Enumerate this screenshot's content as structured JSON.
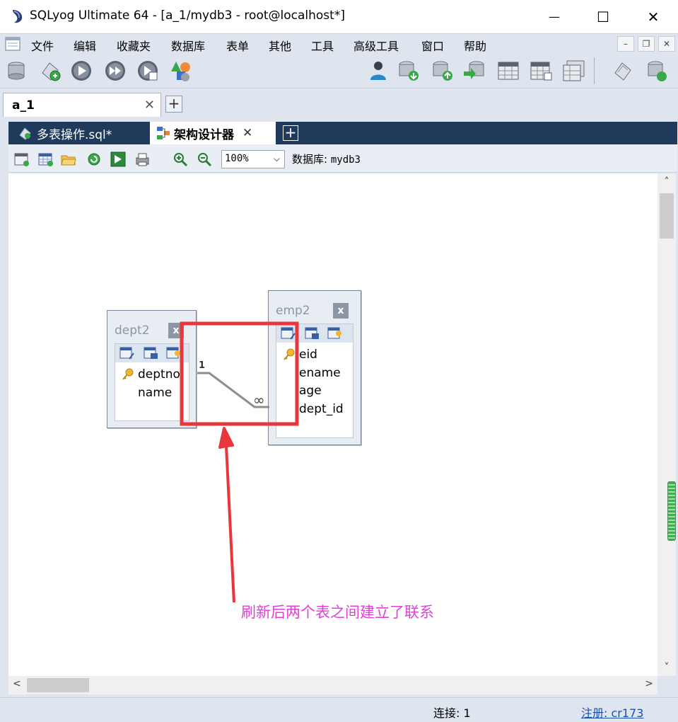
{
  "window": {
    "title": "SQLyog Ultimate 64 - [a_1/mydb3 - root@localhost*]",
    "minimize_glyph": "—",
    "maximize_glyph": "☐",
    "close_glyph": "✕"
  },
  "menu": {
    "items": [
      "文件",
      "编辑",
      "收藏夹",
      "数据库",
      "表单",
      "其他",
      "工具",
      "高级工具",
      "窗口",
      "帮助"
    ],
    "mdi_minimize": "–",
    "mdi_restore": "❐",
    "mdi_close": "✕"
  },
  "toolbar": {
    "database_selected": "mydb3",
    "icons": [
      "new-connection-icon",
      "refresh-connection-icon",
      "execute-query-icon",
      "execute-all-icon",
      "stop-query-icon",
      "shapes-icon",
      "user-manager-icon",
      "backup-database-icon",
      "restore-database-icon",
      "import-icon",
      "table-data-icon",
      "table-grid-icon",
      "table-copy-icon",
      "sql-formatter-icon",
      "db-sync-icon"
    ]
  },
  "connection_tabs": {
    "active_label": "a_1",
    "close_glyph": "✕",
    "add_glyph": "+"
  },
  "doc_tabs": {
    "sql_tab_label": "多表操作.sql*",
    "schema_tab_label": "架构设计器",
    "close_glyph": "✕",
    "add_glyph": "+"
  },
  "designer_toolbar": {
    "zoom_value": "100%",
    "database_label": "数据库:",
    "database_name": "mydb3"
  },
  "tables": [
    {
      "name": "dept2",
      "close_glyph": "x",
      "columns": [
        {
          "name": "deptno",
          "primary_key": true
        },
        {
          "name": "name",
          "primary_key": false
        }
      ]
    },
    {
      "name": "emp2",
      "close_glyph": "x",
      "columns": [
        {
          "name": "eid",
          "primary_key": true
        },
        {
          "name": "ename",
          "primary_key": false
        },
        {
          "name": "age",
          "primary_key": false
        },
        {
          "name": "dept_id",
          "primary_key": false
        }
      ]
    }
  ],
  "relationship": {
    "from_cardinality": "1",
    "to_cardinality": "∞"
  },
  "annotation": {
    "text": "刷新后两个表之间建立了联系",
    "color": "#e33fd8",
    "highlight_color": "#e8363c"
  },
  "statusbar": {
    "connections": "连接: 1",
    "registration": "注册: cr173"
  },
  "scrollbars": {
    "up": "˄",
    "down": "˅",
    "left": "<",
    "right": ">"
  }
}
